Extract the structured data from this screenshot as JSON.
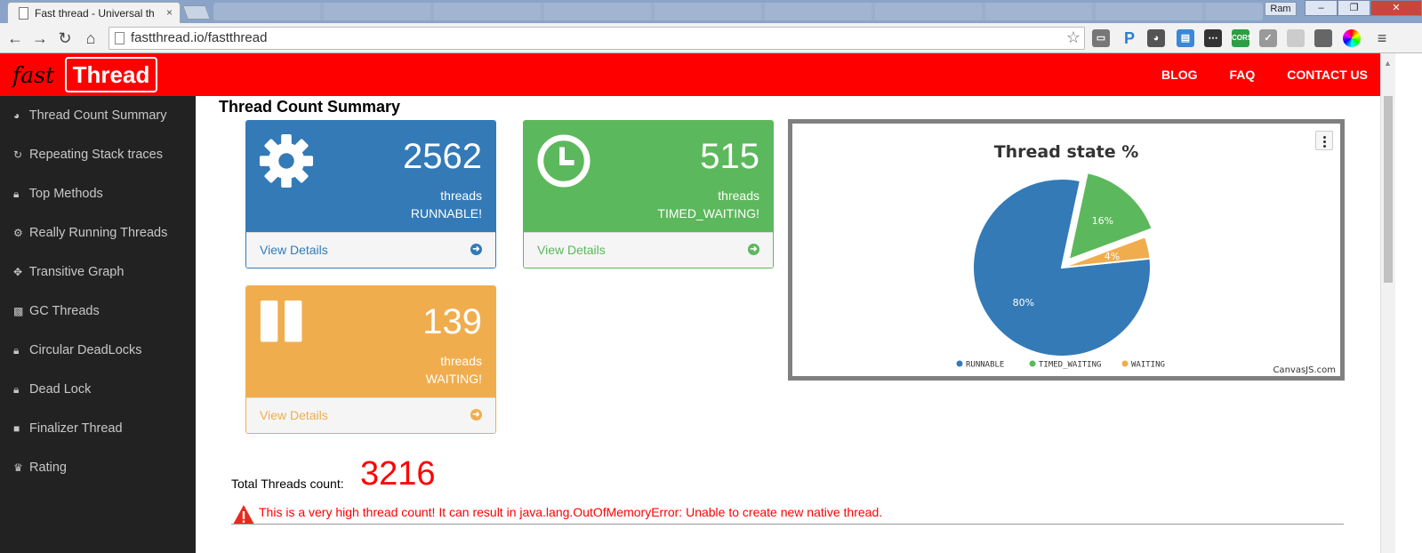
{
  "browser": {
    "tab_title": "Fast thread - Universal th",
    "tab_close": "×",
    "user": "Ram",
    "url": "fastthread.io/fastthread"
  },
  "header": {
    "logo_fast": "fast",
    "logo_thread": "Thread",
    "nav": [
      "BLOG",
      "FAQ",
      "CONTACT US"
    ]
  },
  "sidebar": {
    "items": [
      {
        "label": "Thread Count Summary",
        "icon": "dashboard-icon"
      },
      {
        "label": "Repeating Stack traces",
        "icon": "refresh-icon"
      },
      {
        "label": "Top Methods",
        "icon": "lock-icon"
      },
      {
        "label": "Really Running Threads",
        "icon": "gears-icon"
      },
      {
        "label": "Transitive Graph",
        "icon": "crosshair-icon"
      },
      {
        "label": "GC Threads",
        "icon": "trash-icon"
      },
      {
        "label": "Circular DeadLocks",
        "icon": "lock-icon"
      },
      {
        "label": "Dead Lock",
        "icon": "lock-icon"
      },
      {
        "label": "Finalizer Thread",
        "icon": "stop-icon"
      },
      {
        "label": "Rating",
        "icon": "trophy-icon"
      }
    ]
  },
  "main": {
    "title": "Thread Count Summary",
    "panels": [
      {
        "count": "2562",
        "line1": "threads",
        "line2": "RUNNABLE!",
        "link": "View Details",
        "color": "#337ab7",
        "icon": "gear-icon"
      },
      {
        "count": "515",
        "line1": "threads",
        "line2": "TIMED_WAITING!",
        "link": "View Details",
        "color": "#5cb85c",
        "icon": "clock-icon"
      },
      {
        "count": "139",
        "line1": "threads",
        "line2": "WAITING!",
        "link": "View Details",
        "color": "#f0ad4e",
        "icon": "pause-icon"
      }
    ],
    "total_label": "Total Threads count:",
    "total_value": "3216",
    "warning": "This is a very high thread count! It can result in java.lang.OutOfMemoryError: Unable to create new native thread."
  },
  "chart_data": {
    "type": "pie",
    "title": "Thread state %",
    "categories": [
      "RUNNABLE",
      "TIMED_WAITING",
      "WAITING"
    ],
    "values": [
      80,
      16,
      4
    ],
    "labels": [
      "80%",
      "16%",
      "4%"
    ],
    "colors": [
      "#337ab7",
      "#5cb85c",
      "#f0ad4e"
    ],
    "legend": "bottom",
    "credit": "CanvasJS.com",
    "exploded_index": 1
  }
}
